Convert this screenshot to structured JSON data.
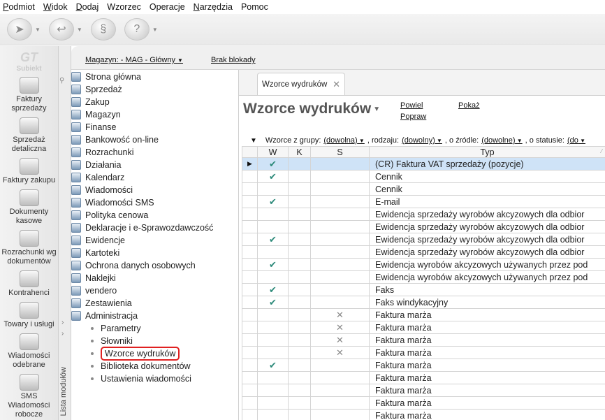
{
  "menu": [
    {
      "first": "P",
      "rest": "odmiot"
    },
    {
      "first": "W",
      "rest": "idok"
    },
    {
      "first": "D",
      "rest": "odaj"
    },
    {
      "first": "",
      "rest": "Wzorzec"
    },
    {
      "first": "",
      "rest": "Operacje"
    },
    {
      "first": "N",
      "rest": "arzędzia"
    },
    {
      "first": "",
      "rest": "Pomoc"
    }
  ],
  "logo": "Subiekt",
  "modules": [
    {
      "label": "Faktury sprzedaży",
      "icon": "invoice-icon"
    },
    {
      "label": "Sprzedaż detaliczna",
      "icon": "retail-icon"
    },
    {
      "label": "Faktury zakupu",
      "icon": "purchase-invoice-icon"
    },
    {
      "label": "Dokumenty kasowe",
      "icon": "cash-documents-icon"
    },
    {
      "label": "Rozrachunki wg dokumentów",
      "icon": "settlements-icon"
    },
    {
      "label": "Kontrahenci",
      "icon": "contractors-icon"
    },
    {
      "label": "Towary i usługi",
      "icon": "goods-icon"
    },
    {
      "label": "Wiadomości odebrane",
      "icon": "inbox-icon"
    },
    {
      "label": "SMS Wiadomości robocze",
      "icon": "sms-icon"
    }
  ],
  "strip_label": "Lista modułów",
  "magbar": {
    "warehouse": "Magazyn: - MAG - Główny",
    "block": "Brak blokady"
  },
  "tree": [
    {
      "label": "Strona główna",
      "icon": "home-icon"
    },
    {
      "label": "Sprzedaż",
      "icon": "sales-icon"
    },
    {
      "label": "Zakup",
      "icon": "purchase-icon"
    },
    {
      "label": "Magazyn",
      "icon": "warehouse-icon"
    },
    {
      "label": "Finanse",
      "icon": "finance-icon"
    },
    {
      "label": "Bankowość on-line",
      "icon": "banking-icon"
    },
    {
      "label": "Rozrachunki",
      "icon": "settlements-icon"
    },
    {
      "label": "Działania",
      "icon": "actions-icon"
    },
    {
      "label": "Kalendarz",
      "icon": "calendar-icon"
    },
    {
      "label": "Wiadomości",
      "icon": "messages-icon"
    },
    {
      "label": "Wiadomości SMS",
      "icon": "sms-icon"
    },
    {
      "label": "Polityka cenowa",
      "icon": "pricing-icon"
    },
    {
      "label": "Deklaracje i e-Sprawozdawczość",
      "icon": "declarations-icon"
    },
    {
      "label": "Ewidencje",
      "icon": "records-icon"
    },
    {
      "label": "Kartoteki",
      "icon": "files-icon"
    },
    {
      "label": "Ochrona danych osobowych",
      "icon": "privacy-icon"
    },
    {
      "label": "Naklejki",
      "icon": "stickers-icon"
    },
    {
      "label": "vendero",
      "icon": "vendero-icon"
    },
    {
      "label": "Zestawienia",
      "icon": "reports-icon"
    },
    {
      "label": "Administracja",
      "icon": "admin-icon"
    }
  ],
  "tree_sub": [
    {
      "label": "Parametry",
      "active": false
    },
    {
      "label": "Słowniki",
      "active": false
    },
    {
      "label": "Wzorce wydruków",
      "active": true
    },
    {
      "label": "Biblioteka dokumentów",
      "active": false
    },
    {
      "label": "Ustawienia wiadomości",
      "active": false
    }
  ],
  "tab": {
    "label": "Wzorce wydruków",
    "close": "✕"
  },
  "page": {
    "title": "Wzorce wydruków",
    "actions": {
      "powiel": "Powiel",
      "popraw": "Popraw",
      "pokaz": "Pokaż"
    }
  },
  "filters": {
    "group_label": "Wzorce z grupy:",
    "group_value": "(dowolna)",
    "type_label": ", rodzaju:",
    "type_value": "(dowolny)",
    "source_label": ", o źródle:",
    "source_value": "(dowolne)",
    "status_label": ", o statusie:",
    "status_value": "(do"
  },
  "grid": {
    "columns": {
      "w": "W",
      "k": "K",
      "s": "S",
      "typ": "Typ"
    },
    "rows": [
      {
        "w": true,
        "s": false,
        "typ": "(CR) Faktura VAT sprzedaży (pozycje)",
        "selected": true
      },
      {
        "w": true,
        "s": false,
        "typ": "Cennik"
      },
      {
        "w": false,
        "s": false,
        "typ": "Cennik"
      },
      {
        "w": true,
        "s": false,
        "typ": "E-mail"
      },
      {
        "w": false,
        "s": false,
        "typ": "Ewidencja sprzedaży wyrobów akcyzowych dla odbior"
      },
      {
        "w": false,
        "s": false,
        "typ": "Ewidencja sprzedaży wyrobów akcyzowych dla odbior"
      },
      {
        "w": true,
        "s": false,
        "typ": "Ewidencja sprzedaży wyrobów akcyzowych dla odbior"
      },
      {
        "w": false,
        "s": false,
        "typ": "Ewidencja sprzedaży wyrobów akcyzowych dla odbior"
      },
      {
        "w": true,
        "s": false,
        "typ": "Ewidencja wyrobów akcyzowych używanych przez pod"
      },
      {
        "w": false,
        "s": false,
        "typ": "Ewidencja wyrobów akcyzowych używanych przez pod"
      },
      {
        "w": true,
        "s": false,
        "typ": "Faks"
      },
      {
        "w": true,
        "s": false,
        "typ": "Faks windykacyjny"
      },
      {
        "w": false,
        "s": true,
        "typ": "Faktura marża"
      },
      {
        "w": false,
        "s": true,
        "typ": "Faktura marża"
      },
      {
        "w": false,
        "s": true,
        "typ": "Faktura marża"
      },
      {
        "w": false,
        "s": true,
        "typ": "Faktura marża"
      },
      {
        "w": true,
        "s": false,
        "typ": "Faktura marża"
      },
      {
        "w": false,
        "s": false,
        "typ": "Faktura marża"
      },
      {
        "w": false,
        "s": false,
        "typ": "Faktura marża"
      },
      {
        "w": false,
        "s": false,
        "typ": "Faktura marża"
      },
      {
        "w": false,
        "s": false,
        "typ": "Faktura marża"
      }
    ]
  }
}
